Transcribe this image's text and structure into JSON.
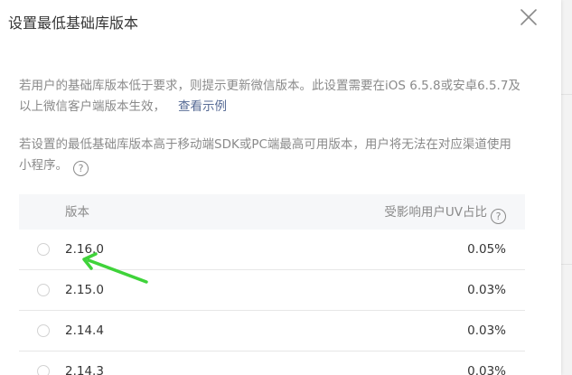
{
  "dialog": {
    "title": "设置最低基础库版本",
    "close_icon": "close-icon"
  },
  "description": {
    "para1_text": "若用户的基础库版本低于要求，则提示更新微信版本。此设置需要在iOS 6.5.8或安卓6.5.7及以上微信客户端版本生效，",
    "para1_link": "查看示例",
    "para2_text": "若设置的最低基础库版本高于移动端SDK或PC端最高可用版本，用户将无法在对应渠道使用小程序。",
    "help_icon_glyph": "?"
  },
  "table": {
    "header_version": "版本",
    "header_uv": "受影响用户UV占比",
    "header_help_glyph": "?",
    "rows": [
      {
        "version": "2.16.0",
        "percent": "0.05%"
      },
      {
        "version": "2.15.0",
        "percent": "0.03%"
      },
      {
        "version": "2.14.4",
        "percent": "0.03%"
      },
      {
        "version": "2.14.3",
        "percent": "0.03%"
      }
    ]
  },
  "annotation": {
    "arrow_color": "#3fd33a",
    "arrow_icon": "green-arrow-annotation"
  },
  "colors": {
    "link": "#576b95",
    "text_primary": "#353535",
    "text_secondary": "#8a8a8a",
    "header_bg": "#f6f7f9"
  }
}
